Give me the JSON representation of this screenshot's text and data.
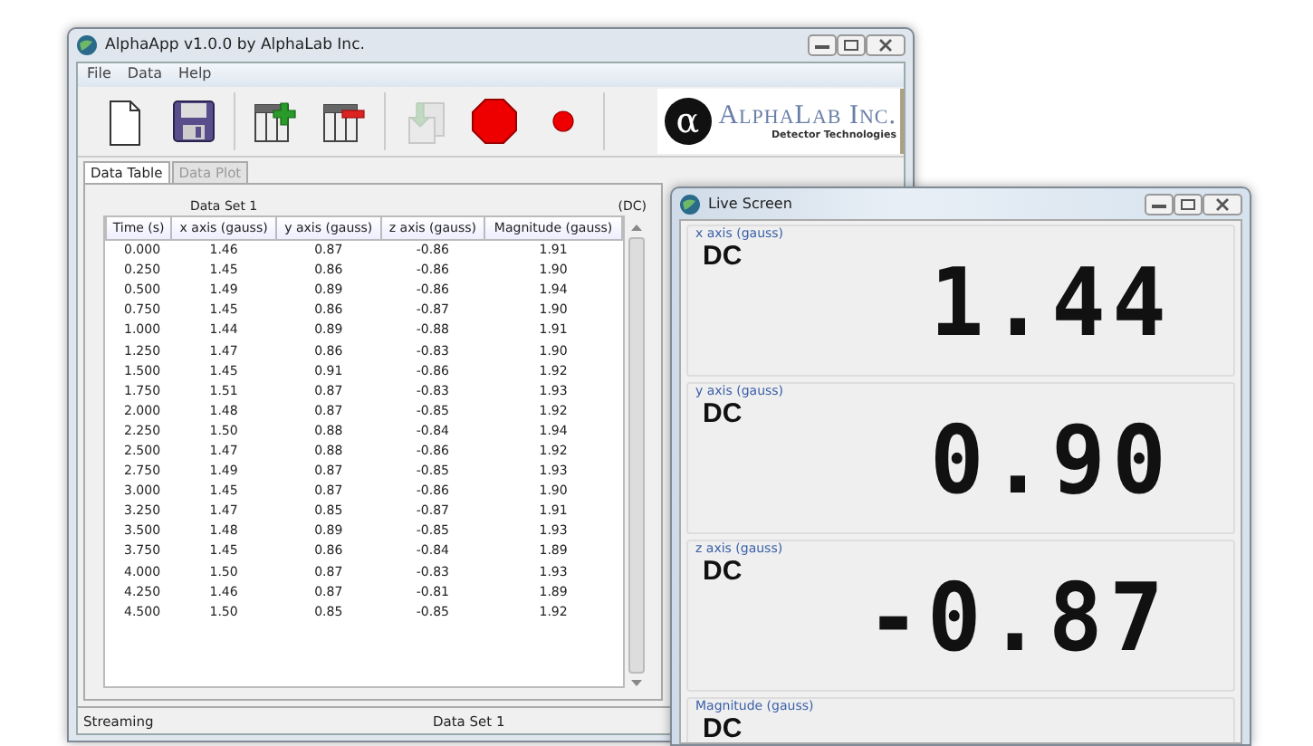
{
  "main_window": {
    "title": "AlphaApp v1.0.0 by AlphaLab Inc.",
    "menu": [
      "File",
      "Data",
      "Help"
    ],
    "logo": {
      "mark": "α",
      "name": "AlphaLab Inc.",
      "tagline": "Detector Technologies"
    },
    "toolbar": [
      {
        "kind": "new",
        "disabled": false
      },
      {
        "kind": "save",
        "disabled": false
      },
      {
        "kind": "add-column",
        "disabled": false
      },
      {
        "kind": "remove-column",
        "disabled": false
      },
      {
        "kind": "import",
        "disabled": true
      },
      {
        "kind": "stop",
        "disabled": false
      },
      {
        "kind": "record",
        "disabled": false
      }
    ],
    "tabs": [
      {
        "label": "Data Table",
        "selected": true
      },
      {
        "label": "Data Plot",
        "selected": false
      }
    ],
    "table": {
      "caption": "Data Set 1",
      "mode": "(DC)",
      "columns": [
        "Time (s)",
        "x axis (gauss)",
        "y axis (gauss)",
        "z axis (gauss)",
        "Magnitude (gauss)"
      ],
      "rows": [
        [
          "0.000",
          "1.46",
          "0.87",
          "-0.86",
          "1.91"
        ],
        [
          "0.250",
          "1.45",
          "0.86",
          "-0.86",
          "1.90"
        ],
        [
          "0.500",
          "1.49",
          "0.89",
          "-0.86",
          "1.94"
        ],
        [
          "0.750",
          "1.45",
          "0.86",
          "-0.87",
          "1.90"
        ],
        [
          "1.000",
          "1.44",
          "0.89",
          "-0.88",
          "1.91"
        ],
        [
          "1.250",
          "1.47",
          "0.86",
          "-0.83",
          "1.90"
        ],
        [
          "1.500",
          "1.45",
          "0.91",
          "-0.86",
          "1.92"
        ],
        [
          "1.750",
          "1.51",
          "0.87",
          "-0.83",
          "1.93"
        ],
        [
          "2.000",
          "1.48",
          "0.87",
          "-0.85",
          "1.92"
        ],
        [
          "2.250",
          "1.50",
          "0.88",
          "-0.84",
          "1.94"
        ],
        [
          "2.500",
          "1.47",
          "0.88",
          "-0.86",
          "1.92"
        ],
        [
          "2.750",
          "1.49",
          "0.87",
          "-0.85",
          "1.93"
        ],
        [
          "3.000",
          "1.45",
          "0.87",
          "-0.86",
          "1.90"
        ],
        [
          "3.250",
          "1.47",
          "0.85",
          "-0.87",
          "1.91"
        ],
        [
          "3.500",
          "1.48",
          "0.89",
          "-0.85",
          "1.93"
        ],
        [
          "3.750",
          "1.45",
          "0.86",
          "-0.84",
          "1.89"
        ],
        [
          "4.000",
          "1.50",
          "0.87",
          "-0.83",
          "1.93"
        ],
        [
          "4.250",
          "1.46",
          "0.87",
          "-0.81",
          "1.89"
        ],
        [
          "4.500",
          "1.50",
          "0.85",
          "-0.85",
          "1.92"
        ]
      ]
    },
    "status_bar": {
      "state": "Streaming",
      "dataset": "Data Set 1"
    }
  },
  "live_screen": {
    "title": "Live Screen",
    "panels": [
      {
        "label": "x axis (gauss)",
        "mode": "DC",
        "reading": "1.44"
      },
      {
        "label": "y axis (gauss)",
        "mode": "DC",
        "reading": "0.90"
      },
      {
        "label": "z axis (gauss)",
        "mode": "DC",
        "reading": "-0.87"
      },
      {
        "label": "Magnitude (gauss)",
        "mode": "DC"
      }
    ]
  }
}
